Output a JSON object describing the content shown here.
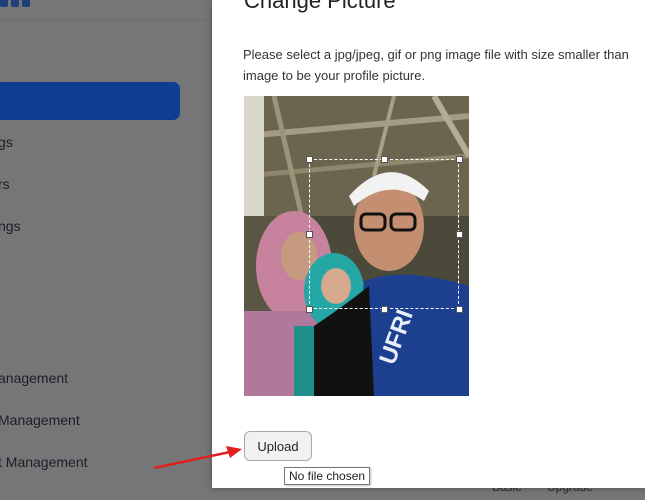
{
  "sidebar": {
    "items": [
      {
        "label": "gs"
      },
      {
        "label": "rs"
      },
      {
        "label": "ngs"
      },
      {
        "label": "anagement"
      },
      {
        "label": "Management"
      },
      {
        "label": "t Management"
      }
    ]
  },
  "bottom_bar": {
    "plan": "Basic",
    "upgrade": "Upgrade"
  },
  "modal": {
    "title": "Change Picture",
    "description_line1": "Please select a jpg/jpeg, gif or png image file with size smaller than",
    "description_line2": "image to be your profile picture.",
    "upload_label": "Upload",
    "file_tooltip": "No file chosen"
  },
  "colors": {
    "overlay": "#747678",
    "active_nav": "#0e3d91",
    "annotation_arrow": "#e02020"
  }
}
